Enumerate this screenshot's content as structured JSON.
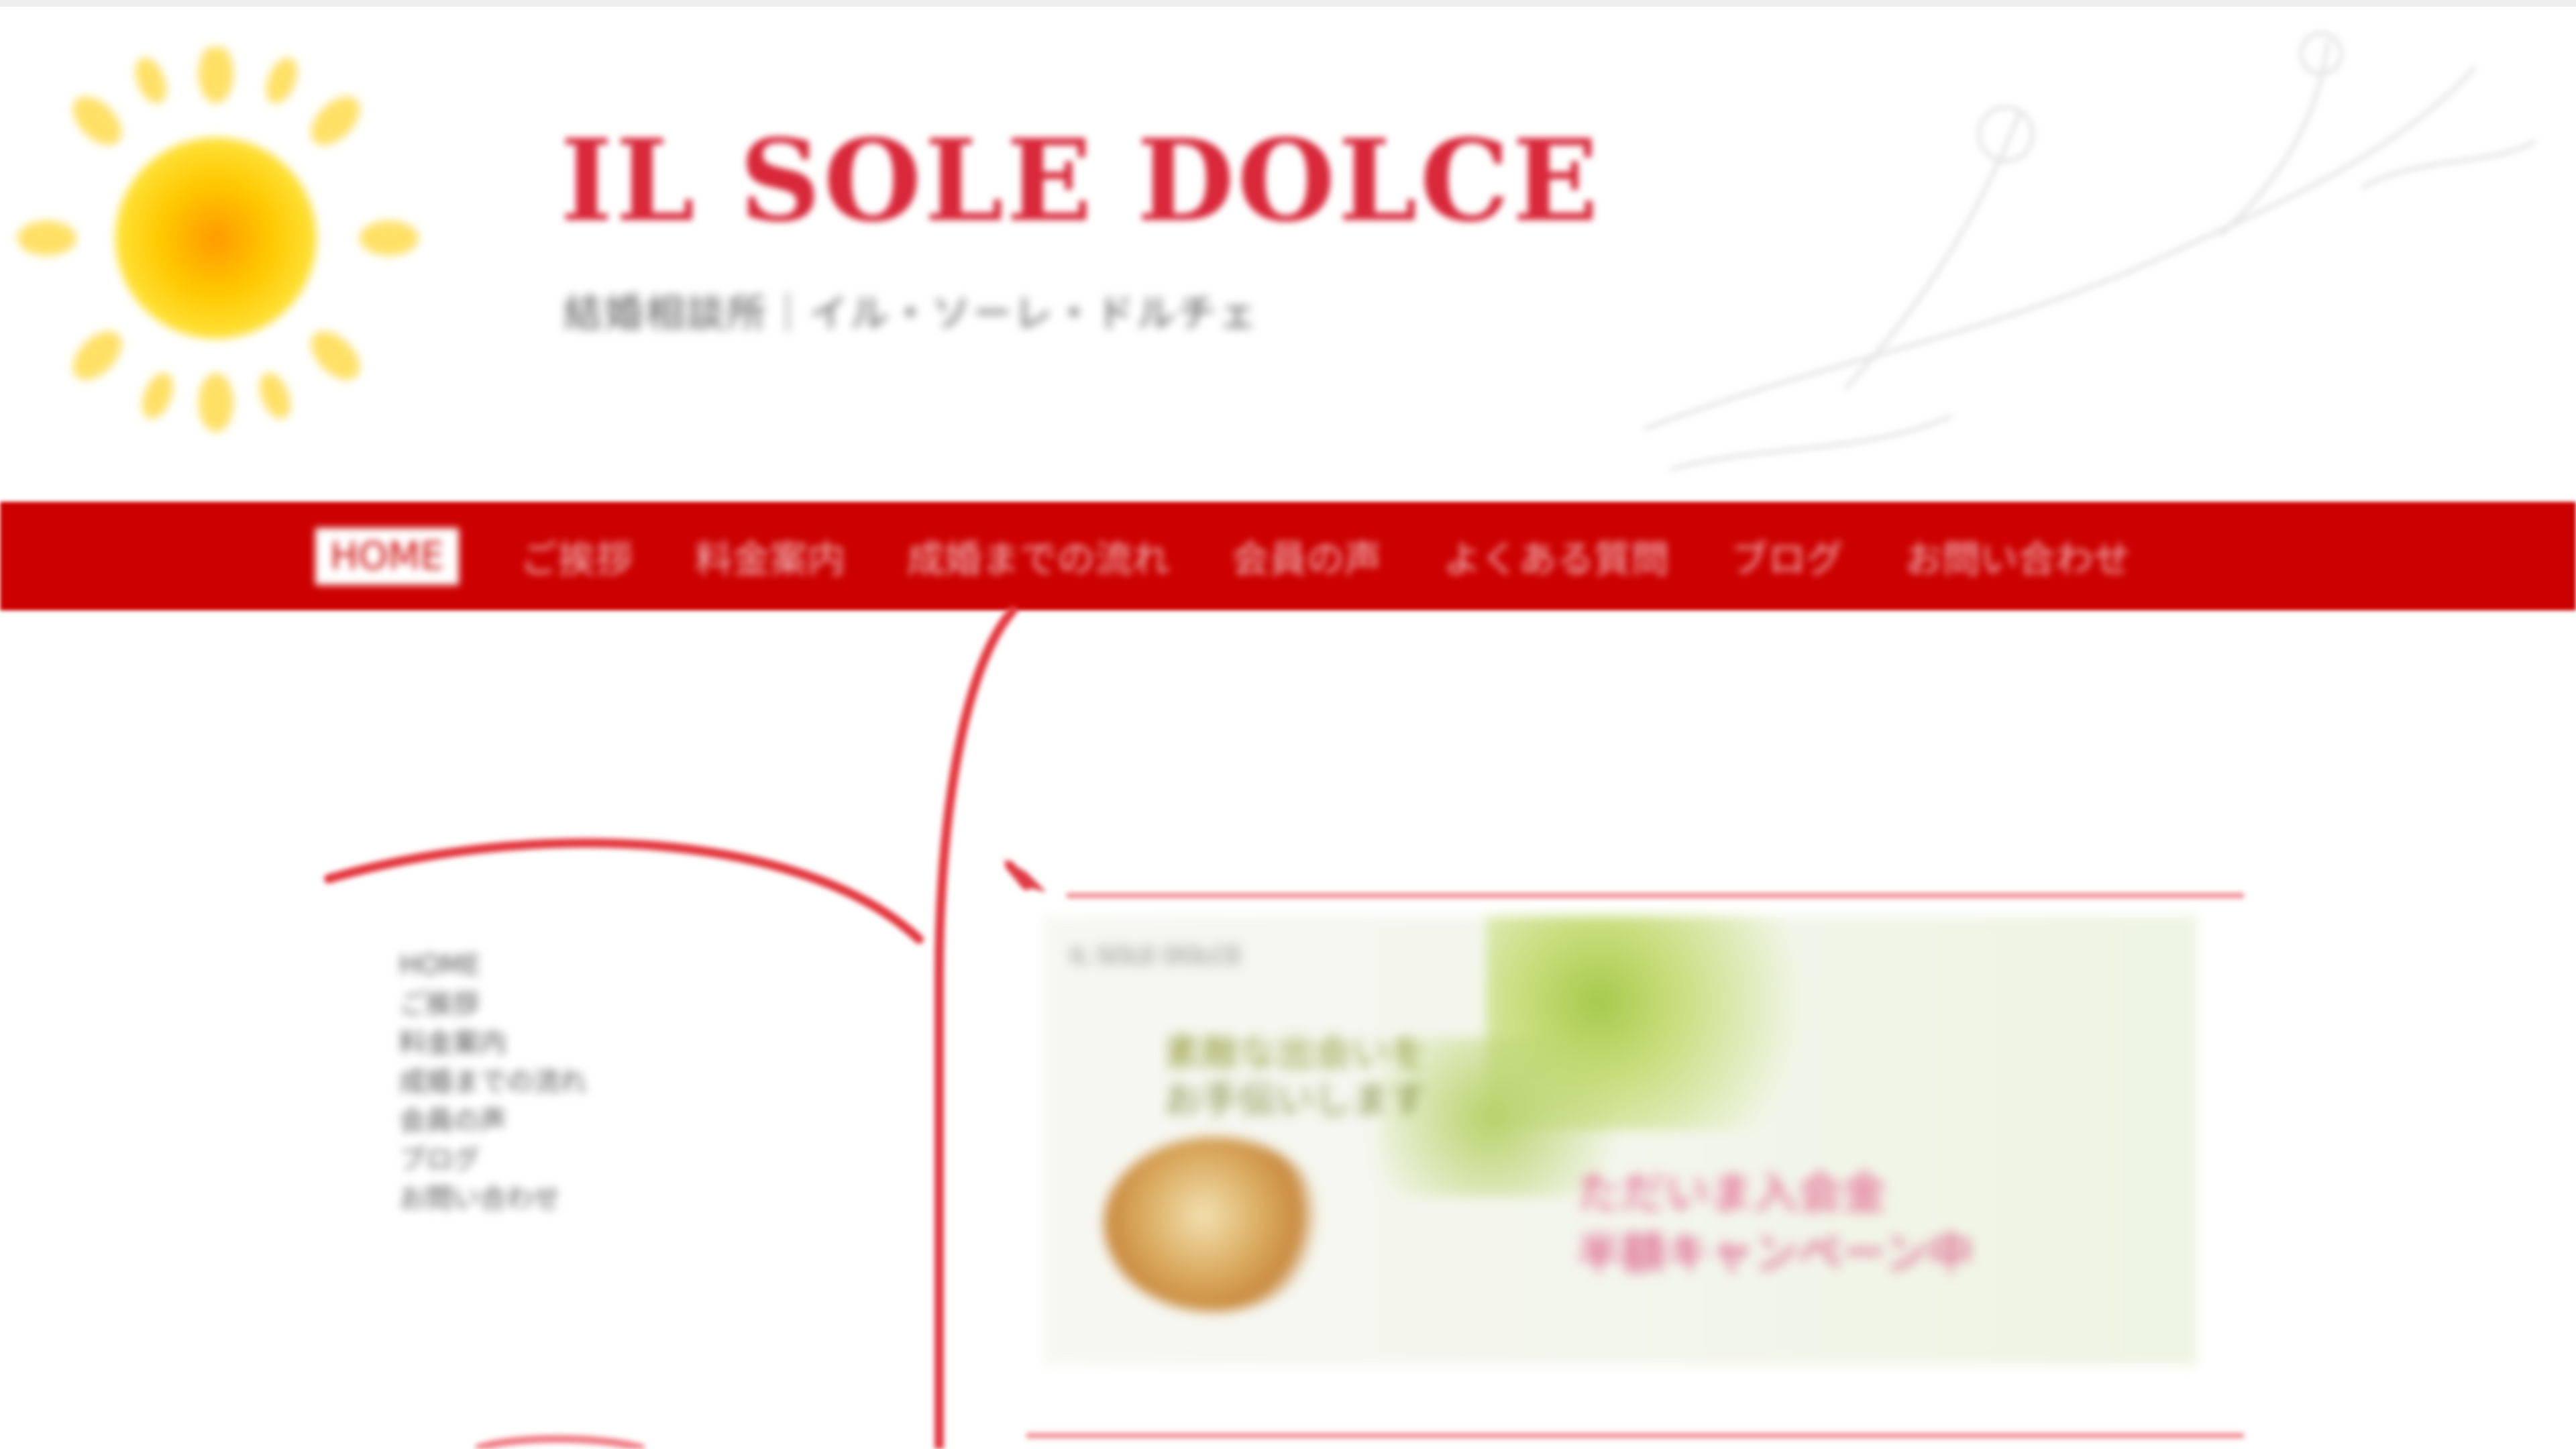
{
  "site": {
    "title": "IL SOLE DOLCE",
    "tagline": "結婚相談所｜イル・ソーレ・ドルチェ"
  },
  "nav": {
    "items": [
      {
        "label": "HOME",
        "active": true
      },
      {
        "label": "ご挨拶"
      },
      {
        "label": "料金案内"
      },
      {
        "label": "成婚までの流れ"
      },
      {
        "label": "会員の声"
      },
      {
        "label": "よくある質問"
      },
      {
        "label": "ブログ"
      },
      {
        "label": "お問い合わせ"
      }
    ]
  },
  "sidebar": {
    "links": [
      "HOME",
      "ご挨拶",
      "料金案内",
      "成婚までの流れ",
      "会員の声",
      "ブログ",
      "お問い合わせ"
    ]
  },
  "banner": {
    "small_text": "IL SOLE DOLCE",
    "copy_line1": "素敵な出会いを",
    "copy_line2": "お手伝いします",
    "promo_line1": "ただいま入会金",
    "promo_line2": "半額キャンペーン中"
  },
  "colors": {
    "accent": "#cc0000",
    "title": "#d8283a",
    "promo": "#e0497a",
    "sun": "#ffd21f"
  },
  "icons": {
    "logo": "sun-logo-icon"
  }
}
